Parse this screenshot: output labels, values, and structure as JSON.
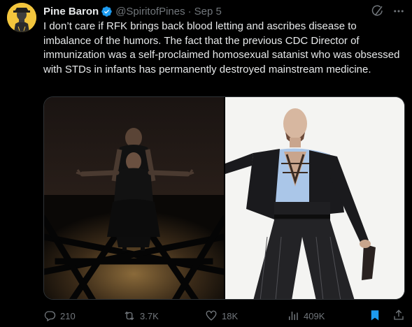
{
  "author": {
    "name": "Pine Baron",
    "handle": "@SpiritofPines",
    "separator": "·",
    "date": "Sep 5"
  },
  "tweet": {
    "text": "I don’t care if RFK brings back blood letting and ascribes disease to imbalance of the humors. The fact that the previous CDC Director of immunization was a self-proclaimed homosexual satanist who was obsessed with STDs in infants has permanently destroyed mainstream medicine."
  },
  "stats": {
    "replies": "210",
    "reposts": "3.7K",
    "likes": "18K",
    "views": "409K"
  },
  "colors": {
    "background": "#000000",
    "text": "#e7e9ea",
    "muted": "#71767b",
    "verified": "#1d9bf0",
    "bookmark_active": "#1d9bf0",
    "avatar_bg": "#f2c53d"
  },
  "icons": {
    "verified": "verified-badge-icon",
    "grok": "grok-icon",
    "more": "more-icon",
    "reply": "reply-icon",
    "repost": "repost-icon",
    "like": "heart-icon",
    "views": "views-icon",
    "bookmark": "bookmark-icon",
    "share": "share-icon"
  }
}
